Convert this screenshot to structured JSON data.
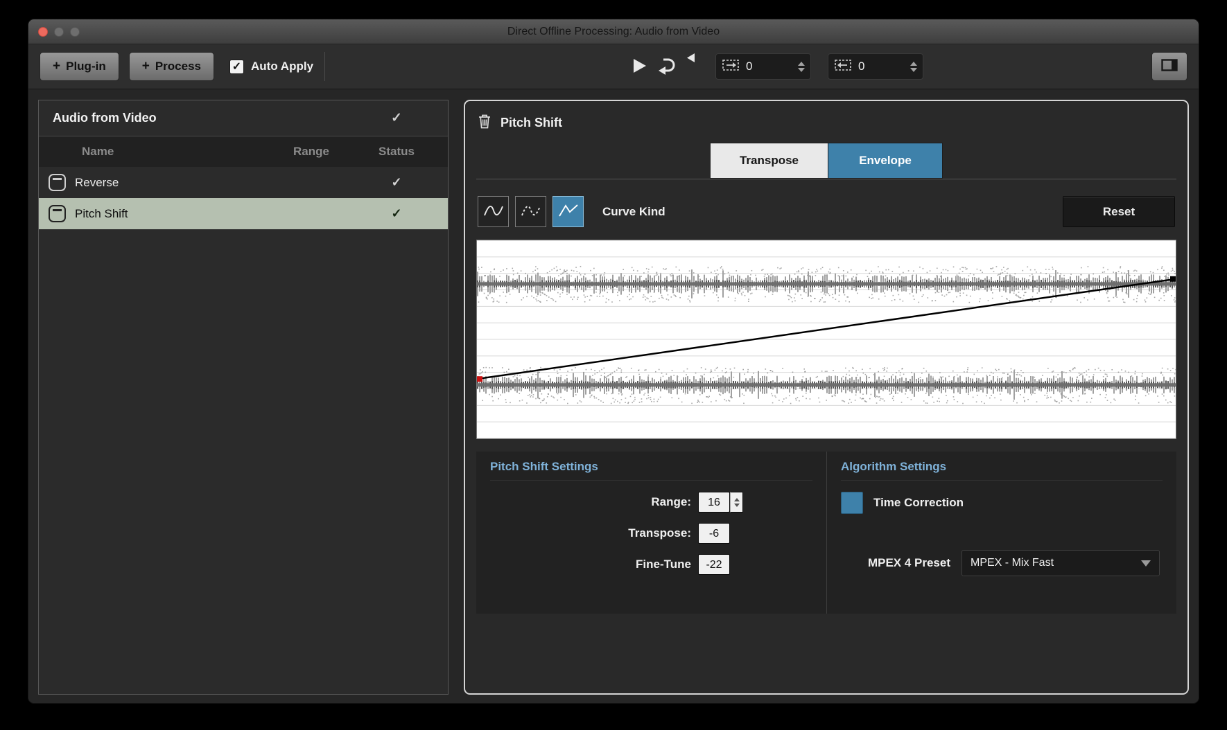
{
  "window": {
    "title": "Direct Offline Processing: Audio from Video"
  },
  "toolbar": {
    "plugin_label": "Plug-in",
    "process_label": "Process",
    "auto_apply_label": "Auto Apply",
    "extend_start_value": "0",
    "extend_end_value": "0"
  },
  "process_list": {
    "title": "Audio from Video",
    "columns": {
      "name": "Name",
      "range": "Range",
      "status": "Status"
    },
    "rows": [
      {
        "name": "Reverse",
        "status": "applied"
      },
      {
        "name": "Pitch Shift",
        "status": "applied",
        "selected": true
      }
    ]
  },
  "editor": {
    "title": "Pitch Shift",
    "tabs": {
      "transpose": "Transpose",
      "envelope": "Envelope"
    },
    "curve_kind_label": "Curve Kind",
    "reset_label": "Reset",
    "pitch_settings": {
      "title": "Pitch Shift Settings",
      "range_label": "Range:",
      "range_value": "16",
      "transpose_label": "Transpose:",
      "transpose_value": "-6",
      "finetune_label": "Fine-Tune",
      "finetune_value": "-22"
    },
    "algorithm_settings": {
      "title": "Algorithm Settings",
      "time_correction_label": "Time Correction",
      "preset_label": "MPEX 4 Preset",
      "preset_value": "MPEX - Mix Fast"
    }
  },
  "icons": {
    "check": "✓",
    "plus": "+"
  },
  "colors": {
    "accent": "#3e81aa",
    "selected_row": "#b5c0b0",
    "envelope_line": "#000000",
    "handle": "#cc1111"
  }
}
